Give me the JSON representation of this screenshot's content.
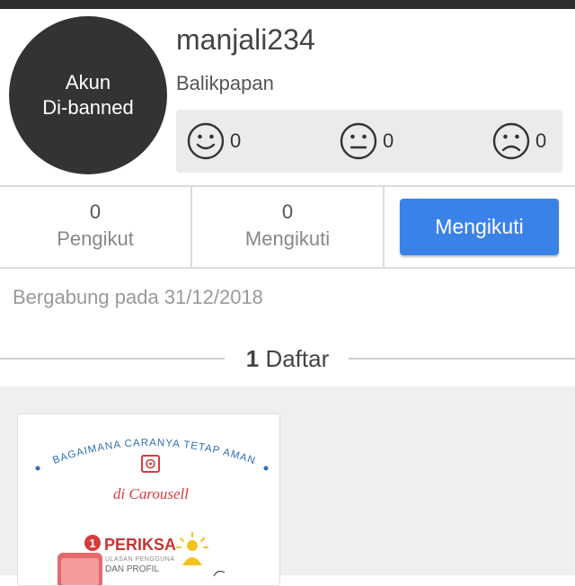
{
  "profile": {
    "avatar_line1": "Akun",
    "avatar_line2": "Di-banned",
    "username": "manjali234",
    "location": "Balikpapan"
  },
  "ratings": {
    "positive": "0",
    "neutral": "0",
    "negative": "0"
  },
  "stats": {
    "followers_count": "0",
    "followers_label": "Pengikut",
    "following_count": "0",
    "following_label": "Mengikuti"
  },
  "actions": {
    "follow_button": "Mengikuti"
  },
  "joined_text": "Bergabung pada 31/12/2018",
  "listings": {
    "count": "1",
    "label": " Daftar",
    "card": {
      "arc_text": "BAGAIMANA CARANYA TETAP AMAN",
      "subtitle": "di Carousell",
      "step_number": "1",
      "step_title": "PERIKSA",
      "step_line1": "ULASAN PENGGUNA",
      "step_line2": "DAN PROFIL"
    }
  },
  "colors": {
    "accent": "#3b82e8",
    "avatar_bg": "#333333",
    "card_red": "#d63b3b",
    "card_blue": "#2f6fb0"
  }
}
